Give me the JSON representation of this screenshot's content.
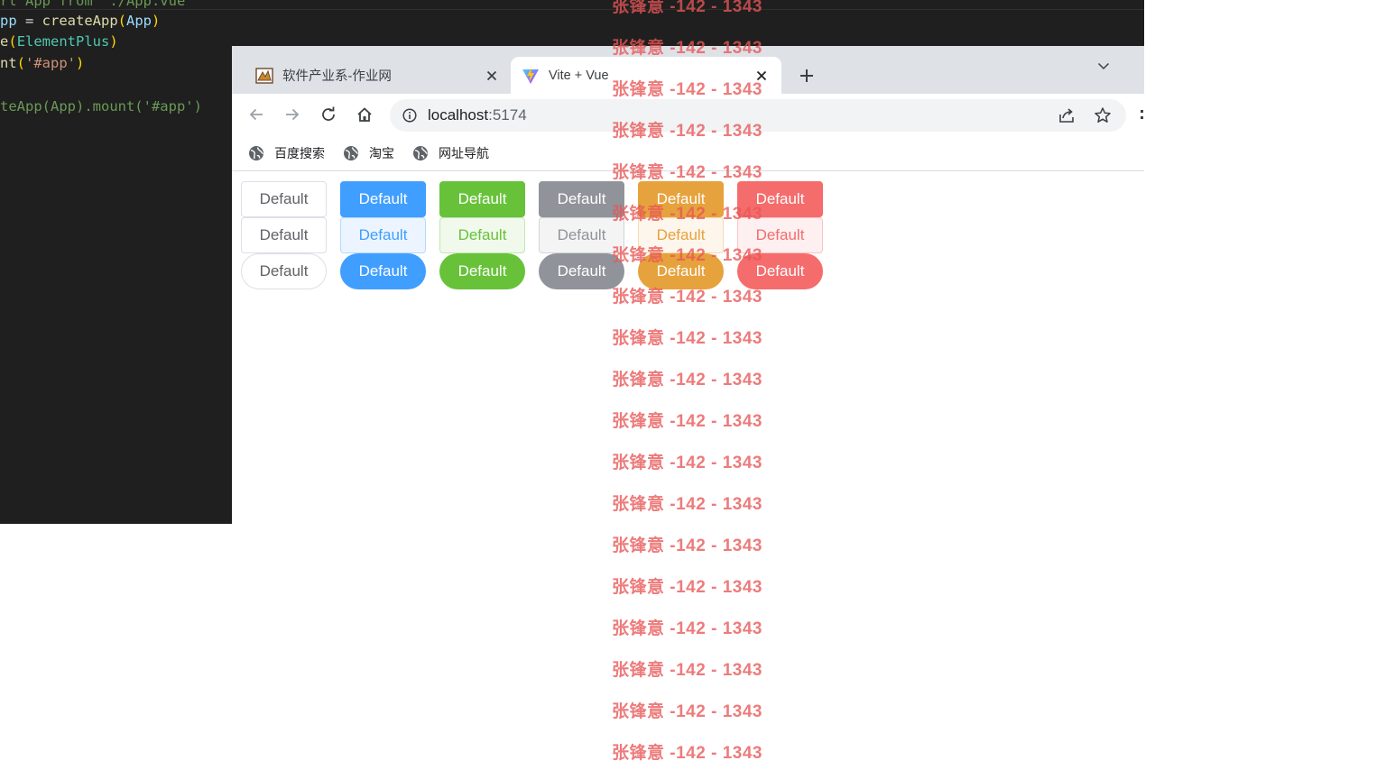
{
  "editor": {
    "lines": [
      [
        {
          "t": "rt App from './App.vue'",
          "c": "tok-dim"
        }
      ],
      [
        {
          "t": "pp",
          "c": "tok-var"
        },
        {
          "t": " = ",
          "c": "tok-op"
        },
        {
          "t": "createApp",
          "c": "tok-fn"
        },
        {
          "t": "(",
          "c": "tok-paren"
        },
        {
          "t": "App",
          "c": "tok-var"
        },
        {
          "t": ")",
          "c": "tok-paren"
        }
      ],
      [
        {
          "t": "e",
          "c": "tok-fn"
        },
        {
          "t": "(",
          "c": "tok-paren"
        },
        {
          "t": "ElementPlus",
          "c": "tok-cls"
        },
        {
          "t": ")",
          "c": "tok-paren"
        }
      ],
      [
        {
          "t": "nt",
          "c": "tok-fn"
        },
        {
          "t": "(",
          "c": "tok-paren"
        },
        {
          "t": "'#app'",
          "c": "tok-str"
        },
        {
          "t": ")",
          "c": "tok-paren"
        }
      ],
      [
        {
          "t": "",
          "c": "tok-op"
        }
      ],
      [
        {
          "t": "teApp(App).mount('#app')",
          "c": "tok-dim"
        }
      ]
    ]
  },
  "browser": {
    "tabs": [
      {
        "title": "软件产业系-作业网",
        "active": false
      },
      {
        "title": "Vite + Vue",
        "active": true
      }
    ],
    "url": {
      "host": "localhost",
      "port": ":5174"
    },
    "bookmarks": [
      {
        "label": "百度搜索"
      },
      {
        "label": "淘宝"
      },
      {
        "label": "网址导航"
      }
    ]
  },
  "page": {
    "button_label": "Default",
    "rows": [
      {
        "style": "solid",
        "round": false,
        "types": [
          "default",
          "primary",
          "success",
          "info",
          "warning",
          "danger"
        ]
      },
      {
        "style": "plain",
        "round": false,
        "types": [
          "default",
          "primary",
          "success",
          "info",
          "warning",
          "danger"
        ]
      },
      {
        "style": "solid",
        "round": true,
        "types": [
          "default",
          "primary",
          "success",
          "info",
          "warning",
          "danger"
        ]
      }
    ]
  },
  "watermark": {
    "text": "张锋意 -142 - 1343",
    "count": 19
  },
  "colors": {
    "primary": "#409eff",
    "success": "#67c23a",
    "info": "#909399",
    "warning": "#e6a23c",
    "danger": "#f56c6c",
    "watermark": "#e85656"
  }
}
